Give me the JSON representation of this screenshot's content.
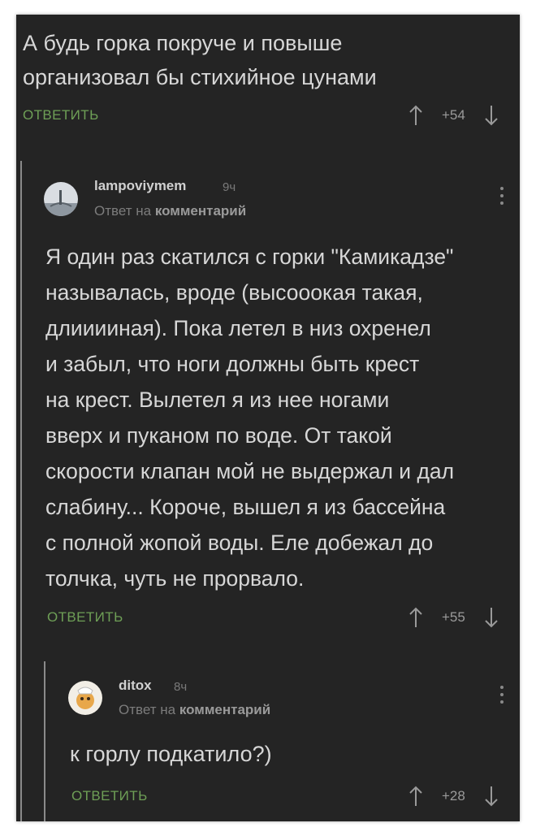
{
  "comment1": {
    "text_line1": "А будь горка покруче и повыше",
    "text_line2": "организовал бы стихийное цунами",
    "reply_label": "ОТВЕТИТЬ",
    "score": "+54"
  },
  "comment2": {
    "username": "lampoviymem",
    "time": "9ч",
    "reply_to_prefix": "Ответ на ",
    "reply_to_target": "комментарий",
    "lines": [
      "Я один раз скатился с горки \"Камикадзе\"",
      "называлась, вроде (высооокая такая,",
      "длииииная). Пока летел в низ охренел",
      "и забыл, что ноги должны быть крест",
      "на крест. Вылетел я из нее ногами",
      "вверх и пуканом по воде. От такой",
      "скорости клапан мой не выдержал и дал",
      "слабину... Короче, вышел я из бассейна",
      "с полной жопой воды. Еле добежал до",
      "толчка, чуть не прорвало."
    ],
    "reply_label": "ОТВЕТИТЬ",
    "score": "+55"
  },
  "comment3": {
    "username": "ditox",
    "time": "8ч",
    "reply_to_prefix": "Ответ на ",
    "reply_to_target": "комментарий",
    "text": "к горлу подкатило?)",
    "reply_label": "ОТВЕТИТЬ",
    "score": "+28"
  },
  "icons": {
    "upvote": "arrow-up-icon",
    "downvote": "arrow-down-icon",
    "menu": "more-vertical-icon"
  },
  "colors": {
    "background": "#242424",
    "text": "#d7d7d7",
    "accent_green": "#6e9f56",
    "muted": "#9a9a9a"
  }
}
